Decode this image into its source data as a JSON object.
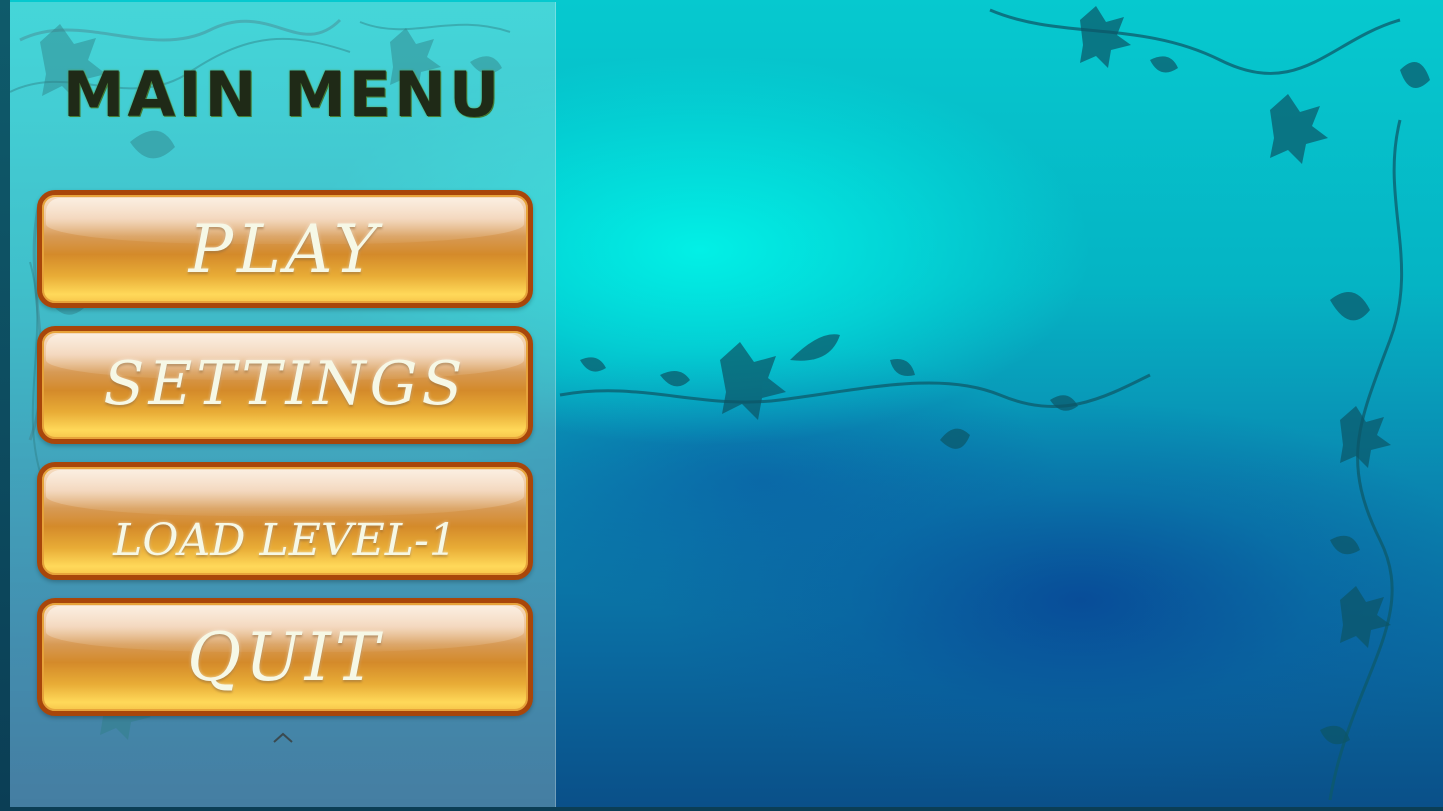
{
  "menu": {
    "title": "MAIN MENU",
    "buttons": [
      {
        "label": "PLAY"
      },
      {
        "label": "SETTINGS"
      },
      {
        "label": "LOAD LEVEL-1"
      },
      {
        "label": "QUIT"
      }
    ],
    "scroll_icon": "chevron-up-icon"
  },
  "colors": {
    "background_cyan": "#02f0e6",
    "background_deep_blue": "#0a4f88",
    "button_orange": "#d48a2a",
    "button_border": "#a8460a",
    "button_text": "#f6f8e6",
    "title_text": "#1f2a17"
  }
}
